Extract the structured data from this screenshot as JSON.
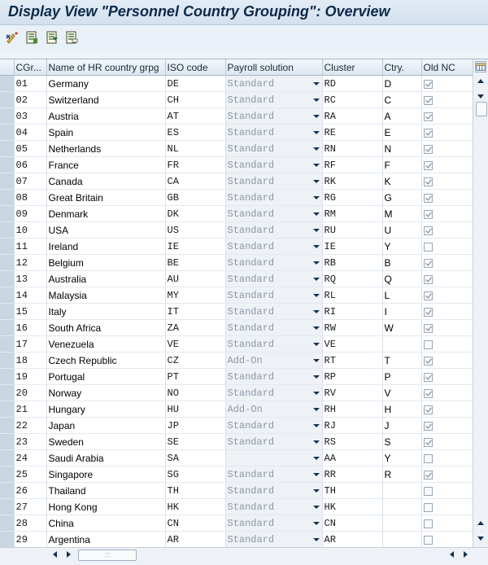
{
  "title": "Display View \"Personnel Country Grouping\": Overview",
  "toolbar": {
    "icons": [
      "change-display-icon",
      "details-icon",
      "select-all-icon",
      "deselect-icon"
    ]
  },
  "columns": {
    "cgr": "CGr...",
    "name": "Name of HR country grpg",
    "iso": "ISO code",
    "payroll": "Payroll solution",
    "cluster": "Cluster",
    "ctry": "Ctry.",
    "oldnc": "Old NC"
  },
  "rows": [
    {
      "cgr": "01",
      "name": "Germany",
      "iso": "DE",
      "payroll": "Standard",
      "cluster": "RD",
      "ctry": "D",
      "oldnc": true
    },
    {
      "cgr": "02",
      "name": "Switzerland",
      "iso": "CH",
      "payroll": "Standard",
      "cluster": "RC",
      "ctry": "C",
      "oldnc": true
    },
    {
      "cgr": "03",
      "name": "Austria",
      "iso": "AT",
      "payroll": "Standard",
      "cluster": "RA",
      "ctry": "A",
      "oldnc": true
    },
    {
      "cgr": "04",
      "name": "Spain",
      "iso": "ES",
      "payroll": "Standard",
      "cluster": "RE",
      "ctry": "E",
      "oldnc": true
    },
    {
      "cgr": "05",
      "name": "Netherlands",
      "iso": "NL",
      "payroll": "Standard",
      "cluster": "RN",
      "ctry": "N",
      "oldnc": true
    },
    {
      "cgr": "06",
      "name": "France",
      "iso": "FR",
      "payroll": "Standard",
      "cluster": "RF",
      "ctry": "F",
      "oldnc": true
    },
    {
      "cgr": "07",
      "name": "Canada",
      "iso": "CA",
      "payroll": "Standard",
      "cluster": "RK",
      "ctry": "K",
      "oldnc": true
    },
    {
      "cgr": "08",
      "name": "Great Britain",
      "iso": "GB",
      "payroll": "Standard",
      "cluster": "RG",
      "ctry": "G",
      "oldnc": true
    },
    {
      "cgr": "09",
      "name": "Denmark",
      "iso": "DK",
      "payroll": "Standard",
      "cluster": "RM",
      "ctry": "M",
      "oldnc": true
    },
    {
      "cgr": "10",
      "name": "USA",
      "iso": "US",
      "payroll": "Standard",
      "cluster": "RU",
      "ctry": "U",
      "oldnc": true
    },
    {
      "cgr": "11",
      "name": "Ireland",
      "iso": "IE",
      "payroll": "Standard",
      "cluster": "IE",
      "ctry": "Y",
      "oldnc": false
    },
    {
      "cgr": "12",
      "name": "Belgium",
      "iso": "BE",
      "payroll": "Standard",
      "cluster": "RB",
      "ctry": "B",
      "oldnc": true
    },
    {
      "cgr": "13",
      "name": "Australia",
      "iso": "AU",
      "payroll": "Standard",
      "cluster": "RQ",
      "ctry": "Q",
      "oldnc": true
    },
    {
      "cgr": "14",
      "name": "Malaysia",
      "iso": "MY",
      "payroll": "Standard",
      "cluster": "RL",
      "ctry": "L",
      "oldnc": true
    },
    {
      "cgr": "15",
      "name": "Italy",
      "iso": "IT",
      "payroll": "Standard",
      "cluster": "RI",
      "ctry": "I",
      "oldnc": true
    },
    {
      "cgr": "16",
      "name": "South Africa",
      "iso": "ZA",
      "payroll": "Standard",
      "cluster": "RW",
      "ctry": "W",
      "oldnc": true
    },
    {
      "cgr": "17",
      "name": "Venezuela",
      "iso": "VE",
      "payroll": "Standard",
      "cluster": "VE",
      "ctry": "",
      "oldnc": false
    },
    {
      "cgr": "18",
      "name": "Czech Republic",
      "iso": "CZ",
      "payroll": "Add-On",
      "cluster": "RT",
      "ctry": "T",
      "oldnc": true
    },
    {
      "cgr": "19",
      "name": "Portugal",
      "iso": "PT",
      "payroll": "Standard",
      "cluster": "RP",
      "ctry": "P",
      "oldnc": true
    },
    {
      "cgr": "20",
      "name": "Norway",
      "iso": "NO",
      "payroll": "Standard",
      "cluster": "RV",
      "ctry": "V",
      "oldnc": true
    },
    {
      "cgr": "21",
      "name": "Hungary",
      "iso": "HU",
      "payroll": "Add-On",
      "cluster": "RH",
      "ctry": "H",
      "oldnc": true
    },
    {
      "cgr": "22",
      "name": "Japan",
      "iso": "JP",
      "payroll": "Standard",
      "cluster": "RJ",
      "ctry": "J",
      "oldnc": true
    },
    {
      "cgr": "23",
      "name": "Sweden",
      "iso": "SE",
      "payroll": "Standard",
      "cluster": "RS",
      "ctry": "S",
      "oldnc": true
    },
    {
      "cgr": "24",
      "name": "Saudi Arabia",
      "iso": "SA",
      "payroll": "",
      "cluster": "AA",
      "ctry": "Y",
      "oldnc": false
    },
    {
      "cgr": "25",
      "name": "Singapore",
      "iso": "SG",
      "payroll": "Standard",
      "cluster": "RR",
      "ctry": "R",
      "oldnc": true
    },
    {
      "cgr": "26",
      "name": "Thailand",
      "iso": "TH",
      "payroll": "Standard",
      "cluster": "TH",
      "ctry": "",
      "oldnc": false
    },
    {
      "cgr": "27",
      "name": "Hong Kong",
      "iso": "HK",
      "payroll": "Standard",
      "cluster": "HK",
      "ctry": "",
      "oldnc": false
    },
    {
      "cgr": "28",
      "name": "China",
      "iso": "CN",
      "payroll": "Standard",
      "cluster": "CN",
      "ctry": "",
      "oldnc": false
    },
    {
      "cgr": "29",
      "name": "Argentina",
      "iso": "AR",
      "payroll": "Standard",
      "cluster": "AR",
      "ctry": "",
      "oldnc": false
    }
  ],
  "colors": {
    "title": "#0c2a4a",
    "header_bg": "#dde6f0",
    "payroll_bg": "#eef2f6",
    "payroll_text": "#8a97a6"
  }
}
